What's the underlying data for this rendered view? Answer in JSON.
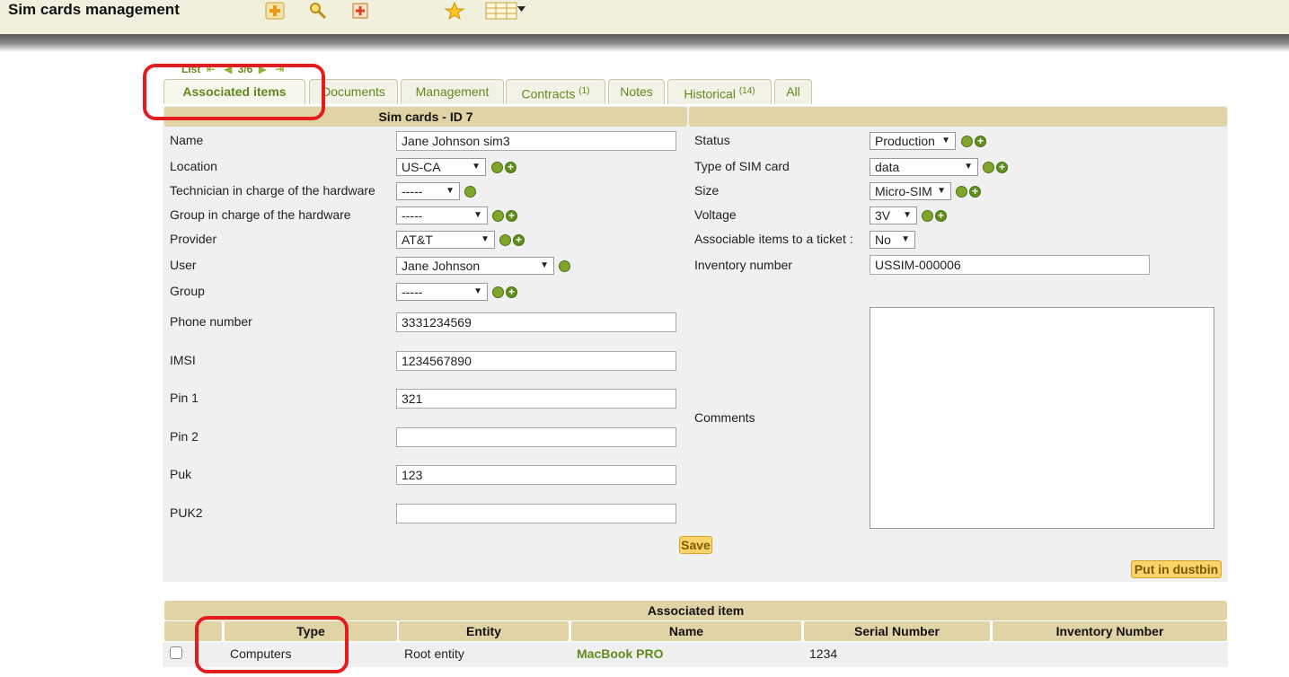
{
  "header": {
    "title": "Sim cards management",
    "toolbar": [
      {
        "icon": "add-icon"
      },
      {
        "icon": "search-icon"
      },
      {
        "icon": "template-icon"
      },
      {
        "icon": "favorite-star-icon"
      },
      {
        "icon": "column-selector-icon"
      }
    ]
  },
  "nav": {
    "list_label": "List",
    "position": "3/6"
  },
  "tabs": [
    {
      "label": "Associated items",
      "count": ""
    },
    {
      "label": "Documents",
      "count": ""
    },
    {
      "label": "Management",
      "count": ""
    },
    {
      "label": "Contracts",
      "count": "(1)"
    },
    {
      "label": "Notes",
      "count": ""
    },
    {
      "label": "Historical",
      "count": "(14)"
    },
    {
      "label": "All",
      "count": ""
    }
  ],
  "form": {
    "header": "Sim cards - ID 7",
    "left": {
      "name": {
        "label": "Name",
        "value": "Jane Johnson sim3"
      },
      "location": {
        "label": "Location",
        "value": "US-CA"
      },
      "technician": {
        "label": "Technician in charge of the hardware",
        "value": "-----"
      },
      "group_hw": {
        "label": "Group in charge of the hardware",
        "value": "-----"
      },
      "provider": {
        "label": "Provider",
        "value": "AT&T"
      },
      "user": {
        "label": "User",
        "value": "Jane Johnson"
      },
      "group": {
        "label": "Group",
        "value": "-----"
      },
      "phone": {
        "label": "Phone number",
        "value": "3331234569"
      },
      "imsi": {
        "label": "IMSI",
        "value": "1234567890"
      },
      "pin1": {
        "label": "Pin 1",
        "value": "321"
      },
      "pin2": {
        "label": "Pin 2",
        "value": ""
      },
      "puk": {
        "label": "Puk",
        "value": "123"
      },
      "puk2": {
        "label": "PUK2",
        "value": ""
      }
    },
    "right": {
      "status": {
        "label": "Status",
        "value": "Production"
      },
      "type": {
        "label": "Type of SIM card",
        "value": "data"
      },
      "size": {
        "label": "Size",
        "value": "Micro-SIM"
      },
      "voltage": {
        "label": "Voltage",
        "value": "3V"
      },
      "associable": {
        "label": "Associable items to a ticket :",
        "value": "No"
      },
      "inventory": {
        "label": "Inventory number",
        "value": "USSIM-000006"
      },
      "comments": {
        "label": "Comments",
        "value": ""
      }
    },
    "save_label": "Save",
    "dustbin_label": "Put in dustbin"
  },
  "associated": {
    "header": "Associated item",
    "columns": [
      "",
      "Type",
      "Entity",
      "Name",
      "Serial Number",
      "Inventory Number"
    ],
    "rows": [
      {
        "type": "Computers",
        "entity": "Root entity",
        "name": "MacBook PRO",
        "serial": "1234",
        "inventory": ""
      }
    ]
  },
  "colors": {
    "header_bg": "#f0f0dc",
    "section_bg": "#e0d4a6",
    "link_green": "#5f8a1c",
    "highlight_red": "#e31d1d",
    "button_yellow": "#fbd469"
  }
}
